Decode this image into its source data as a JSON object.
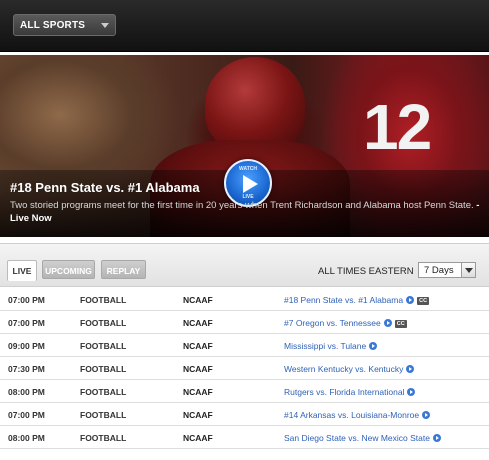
{
  "filter": {
    "sport_label": "ALL SPORTS"
  },
  "hero": {
    "jersey_number": "12",
    "watch_top": "WATCH",
    "watch_bottom": "LIVE",
    "title": "#18 Penn State vs. #1 Alabama",
    "description": "Two storied programs meet for the first time in 20 years when Trent Richardson and Alabama host Penn State.",
    "live_suffix": "- Live Now"
  },
  "tabs": [
    "LIVE",
    "UPCOMING",
    "REPLAY"
  ],
  "timezone_label": "ALL TIMES EASTERN",
  "days_select": "7 Days",
  "colors": {
    "link": "#2f62b8",
    "play_icon": "#3a78d8",
    "topbar": "#1c1c1c"
  },
  "schedule": [
    {
      "time": "07:00 PM",
      "sport": "FOOTBALL",
      "league": "NCAAF",
      "game": "#18 Penn State vs. #1 Alabama",
      "cc": "CC"
    },
    {
      "time": "07:00 PM",
      "sport": "FOOTBALL",
      "league": "NCAAF",
      "game": "#7 Oregon vs. Tennessee",
      "cc": "CC"
    },
    {
      "time": "09:00 PM",
      "sport": "FOOTBALL",
      "league": "NCAAF",
      "game": "Mississippi vs. Tulane",
      "cc": ""
    },
    {
      "time": "07:30 PM",
      "sport": "FOOTBALL",
      "league": "NCAAF",
      "game": "Western Kentucky vs. Kentucky",
      "cc": ""
    },
    {
      "time": "08:00 PM",
      "sport": "FOOTBALL",
      "league": "NCAAF",
      "game": "Rutgers vs. Florida International",
      "cc": ""
    },
    {
      "time": "07:00 PM",
      "sport": "FOOTBALL",
      "league": "NCAAF",
      "game": "#14 Arkansas vs. Louisiana-Monroe",
      "cc": ""
    },
    {
      "time": "08:00 PM",
      "sport": "FOOTBALL",
      "league": "NCAAF",
      "game": "San Diego State vs. New Mexico State",
      "cc": ""
    }
  ]
}
